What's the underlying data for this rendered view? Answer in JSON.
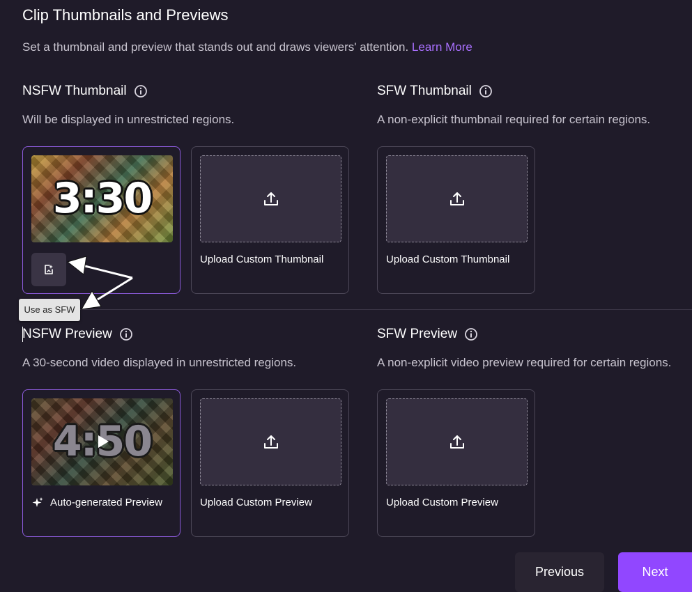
{
  "header": {
    "title": "Clip Thumbnails and Previews",
    "description": "Set a thumbnail and preview that stands out and draws viewers' attention.",
    "learn_more": "Learn More"
  },
  "nsfw_thumbnail": {
    "title": "NSFW Thumbnail",
    "description": "Will be displayed in unrestricted regions.",
    "current_thumb_time": "3:30",
    "use_as_sfw_tooltip": "Use as SFW",
    "upload_label": "Upload Custom Thumbnail"
  },
  "sfw_thumbnail": {
    "title": "SFW Thumbnail",
    "description": "A non-explicit thumbnail required for certain regions.",
    "upload_label": "Upload Custom Thumbnail"
  },
  "nsfw_preview": {
    "title": "NSFW Preview",
    "description": "A 30-second video displayed in unrestricted regions.",
    "current_preview_time": "4:50",
    "auto_label": "Auto-generated Preview",
    "upload_label": "Upload Custom Preview"
  },
  "sfw_preview": {
    "title": "SFW Preview",
    "description": "A non-explicit video preview required for certain regions.",
    "upload_label": "Upload Custom Preview"
  },
  "footer": {
    "previous_label": "Previous",
    "next_label": "Next"
  },
  "icons": {
    "info": "info-icon",
    "upload": "upload-icon",
    "use_as_sfw": "image-sparkle-icon",
    "sparkle": "sparkle-icon",
    "play": "play-icon"
  },
  "colors": {
    "background": "#1f1b29",
    "accent": "#9147ff",
    "link": "#a970ff",
    "selected_border": "#8c5bdb",
    "card_border": "#4d4858"
  }
}
